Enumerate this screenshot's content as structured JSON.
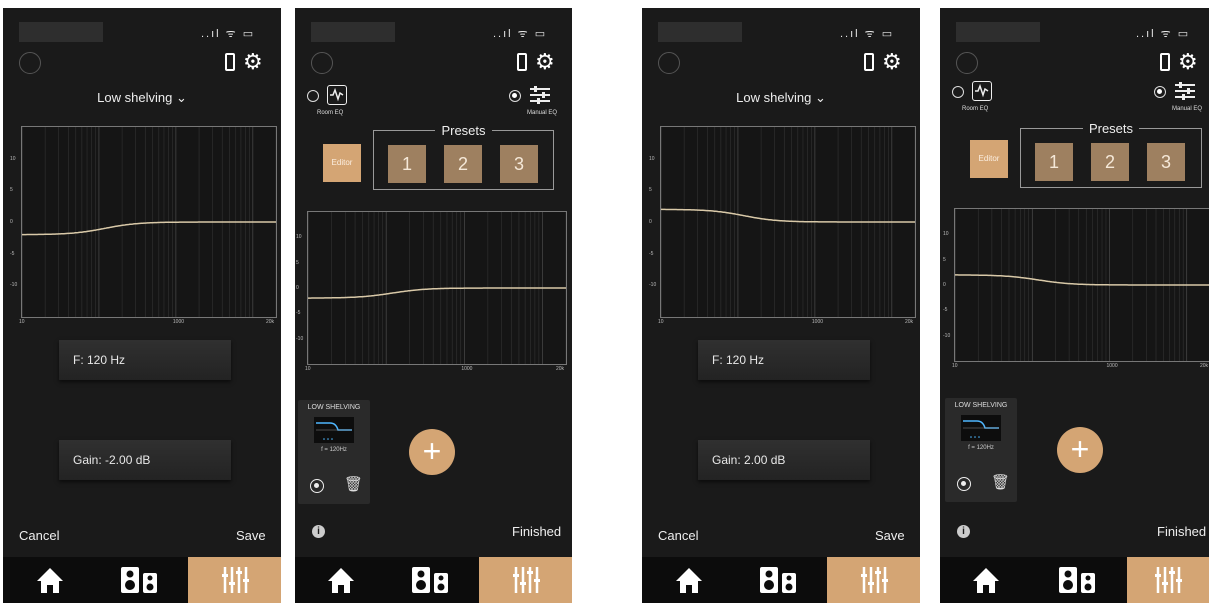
{
  "status": {
    "icons": "..ıl ᯤ ▭"
  },
  "icons": {
    "home": "home-icon",
    "speakers": "speakers-icon",
    "eq": "eq-sliders-icon",
    "settings": "gear-icon",
    "device": "phone-icon"
  },
  "colors": {
    "accent": "#d4a574",
    "preset": "#9e8060",
    "curve": "#d9c9a8",
    "background": "#1a1a1a"
  },
  "graph": {
    "y_ticks": [
      "10",
      "5",
      "0",
      "-5",
      "-10"
    ],
    "x_ticks": [
      "10",
      "1000",
      "20k"
    ]
  },
  "screen1": {
    "filter_type": "Low shelving",
    "chevron": "⌄",
    "frequency": "F: 120 Hz",
    "gain": "Gain: -2.00 dB",
    "cancel": "Cancel",
    "save": "Save",
    "curve_gain_db": -2
  },
  "screen2": {
    "room_eq_label": "Room EQ",
    "manual_eq_label": "Manual EQ",
    "presets_title": "Presets",
    "editor_label": "Editor",
    "presets": [
      "1",
      "2",
      "3"
    ],
    "filter_card_title": "LOW SHELVING",
    "filter_card_freq": "f = 120Hz",
    "add": "+",
    "finished": "Finished",
    "info": "i",
    "curve_gain_db": -2
  },
  "screen3": {
    "filter_type": "Low shelving",
    "chevron": "⌄",
    "frequency": "F: 120 Hz",
    "gain": "Gain: 2.00 dB",
    "cancel": "Cancel",
    "save": "Save",
    "curve_gain_db": 2
  },
  "screen4": {
    "room_eq_label": "Room EQ",
    "manual_eq_label": "Manual EQ",
    "presets_title": "Presets",
    "editor_label": "Editor",
    "presets": [
      "1",
      "2",
      "3"
    ],
    "filter_card_title": "LOW SHELVING",
    "filter_card_freq": "f = 120Hz",
    "add": "+",
    "finished": "Finished",
    "info": "i",
    "curve_gain_db": 2
  }
}
